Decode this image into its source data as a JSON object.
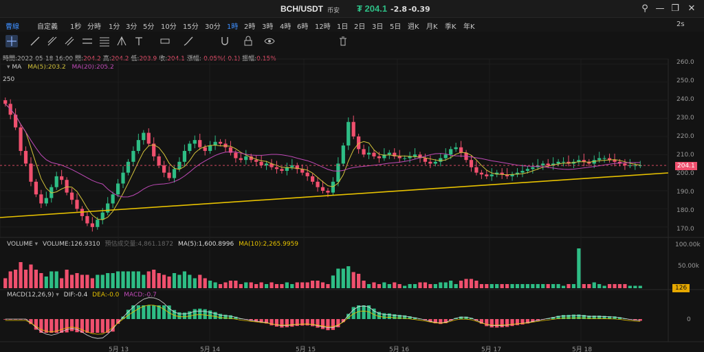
{
  "title": {
    "pair": "BCH/USDT",
    "exchange": "币安",
    "price": "₮ 204.1",
    "change": "-2.8",
    "change_pct": "-0.39"
  },
  "window_controls": [
    "search-icon",
    "restore-icon",
    "maximize-icon",
    "close-icon"
  ],
  "intervals": [
    "曹線",
    "自定義",
    "1秒",
    "分時",
    "1分",
    "3分",
    "5分",
    "10分",
    "15分",
    "30分",
    "1時",
    "2時",
    "3時",
    "4時",
    "6時",
    "12時",
    "1日",
    "2日",
    "3日",
    "5日",
    "週K",
    "月K",
    "季K",
    "年K"
  ],
  "active_interval": "1時",
  "refresh": "2s",
  "tools": [
    "crosshair-icon",
    "trendline-icon",
    "ray-icon",
    "parallel-icon",
    "channel-icon",
    "fib-icon",
    "pitchfork-icon",
    "text-icon",
    "ruler-icon",
    "brush-icon",
    "magnet-icon",
    "lock-icon",
    "eye-icon",
    "delete-icon"
  ],
  "info": {
    "time_label": "時間:",
    "time": "2022-05-18 16:00",
    "open_label": "開:",
    "open": "204.2",
    "high_label": "高:",
    "high": "204.2",
    "low_label": "低:",
    "low": "203.9",
    "close_label": "收:",
    "close": "204.1",
    "change_label": "漲幅:",
    "change": "-0.05%(-0.1)",
    "amp_label": "振幅:",
    "amp": "0.15%"
  },
  "ma_legend": {
    "name": "MA",
    "ma5": "MA(5):203.2",
    "ma20": "MA(20):205.2"
  },
  "colors": {
    "up": "#2ebd85",
    "down": "#f0506e",
    "ma5": "#d4c33b",
    "ma20": "#c04ab8",
    "trend": "#e8c200",
    "accent": "#3e8fff"
  },
  "price_axis": [
    "260.0",
    "250.0",
    "240.0",
    "230.0",
    "220.0",
    "210.0",
    "200.0",
    "190.0",
    "180.0",
    "170.0"
  ],
  "price_tag": "204.1",
  "high_marker": "250",
  "volume": {
    "name": "VOLUME",
    "volume": "VOLUME:126.9310",
    "est": "預估成交量:4,861.1872",
    "ma5": "MA(5):1,600.8996",
    "ma10": "MA(10):2,265.9959",
    "axis": [
      "100.00k",
      "50.00k"
    ],
    "tag": "126"
  },
  "macd": {
    "name": "MACD(12,26,9)",
    "dif": "DIF:-0.4",
    "dea": "DEA:-0.0",
    "macd": "MACD:-0.7",
    "axis_zero": "0"
  },
  "dates": [
    "5月 13",
    "5月 14",
    "5月 15",
    "5月 16",
    "5月 17",
    "5月 18"
  ],
  "chart_data": {
    "type": "candlestick",
    "y_range": [
      165,
      262
    ],
    "candles_close": [
      238,
      232,
      225,
      212,
      205,
      195,
      188,
      183,
      186,
      192,
      198,
      196,
      189,
      185,
      180,
      176,
      172,
      170,
      174,
      178,
      183,
      188,
      194,
      200,
      206,
      212,
      218,
      222,
      216,
      209,
      204,
      200,
      197,
      202,
      206,
      212,
      216,
      218,
      214,
      212,
      215,
      217,
      216,
      214,
      211,
      208,
      207,
      209,
      207,
      206,
      204,
      205,
      203,
      202,
      201,
      203,
      204,
      202,
      200,
      198,
      195,
      192,
      190,
      189,
      195,
      205,
      215,
      228,
      220,
      213,
      210,
      211,
      209,
      208,
      210,
      211,
      209,
      208,
      208,
      209,
      210,
      208,
      206,
      205,
      206,
      208,
      210,
      213,
      214,
      211,
      207,
      203,
      200,
      199,
      198,
      199,
      200,
      199,
      198,
      199,
      200,
      201,
      202,
      203,
      204,
      205,
      204,
      205,
      206,
      206,
      205,
      206,
      207,
      206,
      205,
      207,
      208,
      208,
      207,
      206,
      205,
      204,
      204,
      204,
      204
    ]
  }
}
